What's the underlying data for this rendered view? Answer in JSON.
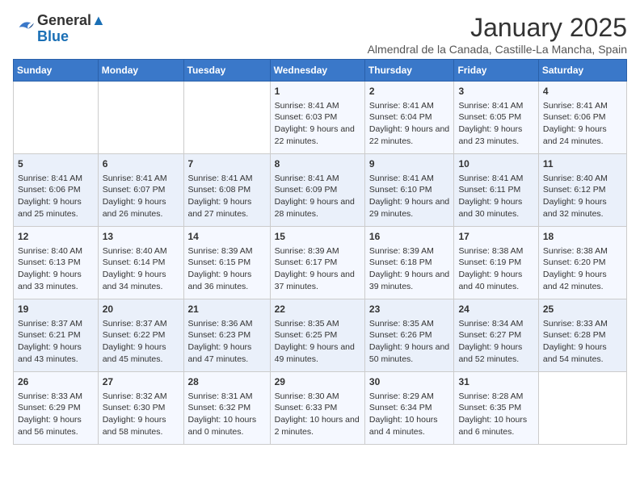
{
  "logo": {
    "line1": "General",
    "line2": "Blue"
  },
  "title": "January 2025",
  "subtitle": "Almendral de la Canada, Castille-La Mancha, Spain",
  "weekdays": [
    "Sunday",
    "Monday",
    "Tuesday",
    "Wednesday",
    "Thursday",
    "Friday",
    "Saturday"
  ],
  "weeks": [
    [
      {
        "day": "",
        "info": ""
      },
      {
        "day": "",
        "info": ""
      },
      {
        "day": "",
        "info": ""
      },
      {
        "day": "1",
        "info": "Sunrise: 8:41 AM\nSunset: 6:03 PM\nDaylight: 9 hours and 22 minutes."
      },
      {
        "day": "2",
        "info": "Sunrise: 8:41 AM\nSunset: 6:04 PM\nDaylight: 9 hours and 22 minutes."
      },
      {
        "day": "3",
        "info": "Sunrise: 8:41 AM\nSunset: 6:05 PM\nDaylight: 9 hours and 23 minutes."
      },
      {
        "day": "4",
        "info": "Sunrise: 8:41 AM\nSunset: 6:06 PM\nDaylight: 9 hours and 24 minutes."
      }
    ],
    [
      {
        "day": "5",
        "info": "Sunrise: 8:41 AM\nSunset: 6:06 PM\nDaylight: 9 hours and 25 minutes."
      },
      {
        "day": "6",
        "info": "Sunrise: 8:41 AM\nSunset: 6:07 PM\nDaylight: 9 hours and 26 minutes."
      },
      {
        "day": "7",
        "info": "Sunrise: 8:41 AM\nSunset: 6:08 PM\nDaylight: 9 hours and 27 minutes."
      },
      {
        "day": "8",
        "info": "Sunrise: 8:41 AM\nSunset: 6:09 PM\nDaylight: 9 hours and 28 minutes."
      },
      {
        "day": "9",
        "info": "Sunrise: 8:41 AM\nSunset: 6:10 PM\nDaylight: 9 hours and 29 minutes."
      },
      {
        "day": "10",
        "info": "Sunrise: 8:41 AM\nSunset: 6:11 PM\nDaylight: 9 hours and 30 minutes."
      },
      {
        "day": "11",
        "info": "Sunrise: 8:40 AM\nSunset: 6:12 PM\nDaylight: 9 hours and 32 minutes."
      }
    ],
    [
      {
        "day": "12",
        "info": "Sunrise: 8:40 AM\nSunset: 6:13 PM\nDaylight: 9 hours and 33 minutes."
      },
      {
        "day": "13",
        "info": "Sunrise: 8:40 AM\nSunset: 6:14 PM\nDaylight: 9 hours and 34 minutes."
      },
      {
        "day": "14",
        "info": "Sunrise: 8:39 AM\nSunset: 6:15 PM\nDaylight: 9 hours and 36 minutes."
      },
      {
        "day": "15",
        "info": "Sunrise: 8:39 AM\nSunset: 6:17 PM\nDaylight: 9 hours and 37 minutes."
      },
      {
        "day": "16",
        "info": "Sunrise: 8:39 AM\nSunset: 6:18 PM\nDaylight: 9 hours and 39 minutes."
      },
      {
        "day": "17",
        "info": "Sunrise: 8:38 AM\nSunset: 6:19 PM\nDaylight: 9 hours and 40 minutes."
      },
      {
        "day": "18",
        "info": "Sunrise: 8:38 AM\nSunset: 6:20 PM\nDaylight: 9 hours and 42 minutes."
      }
    ],
    [
      {
        "day": "19",
        "info": "Sunrise: 8:37 AM\nSunset: 6:21 PM\nDaylight: 9 hours and 43 minutes."
      },
      {
        "day": "20",
        "info": "Sunrise: 8:37 AM\nSunset: 6:22 PM\nDaylight: 9 hours and 45 minutes."
      },
      {
        "day": "21",
        "info": "Sunrise: 8:36 AM\nSunset: 6:23 PM\nDaylight: 9 hours and 47 minutes."
      },
      {
        "day": "22",
        "info": "Sunrise: 8:35 AM\nSunset: 6:25 PM\nDaylight: 9 hours and 49 minutes."
      },
      {
        "day": "23",
        "info": "Sunrise: 8:35 AM\nSunset: 6:26 PM\nDaylight: 9 hours and 50 minutes."
      },
      {
        "day": "24",
        "info": "Sunrise: 8:34 AM\nSunset: 6:27 PM\nDaylight: 9 hours and 52 minutes."
      },
      {
        "day": "25",
        "info": "Sunrise: 8:33 AM\nSunset: 6:28 PM\nDaylight: 9 hours and 54 minutes."
      }
    ],
    [
      {
        "day": "26",
        "info": "Sunrise: 8:33 AM\nSunset: 6:29 PM\nDaylight: 9 hours and 56 minutes."
      },
      {
        "day": "27",
        "info": "Sunrise: 8:32 AM\nSunset: 6:30 PM\nDaylight: 9 hours and 58 minutes."
      },
      {
        "day": "28",
        "info": "Sunrise: 8:31 AM\nSunset: 6:32 PM\nDaylight: 10 hours and 0 minutes."
      },
      {
        "day": "29",
        "info": "Sunrise: 8:30 AM\nSunset: 6:33 PM\nDaylight: 10 hours and 2 minutes."
      },
      {
        "day": "30",
        "info": "Sunrise: 8:29 AM\nSunset: 6:34 PM\nDaylight: 10 hours and 4 minutes."
      },
      {
        "day": "31",
        "info": "Sunrise: 8:28 AM\nSunset: 6:35 PM\nDaylight: 10 hours and 6 minutes."
      },
      {
        "day": "",
        "info": ""
      }
    ]
  ]
}
